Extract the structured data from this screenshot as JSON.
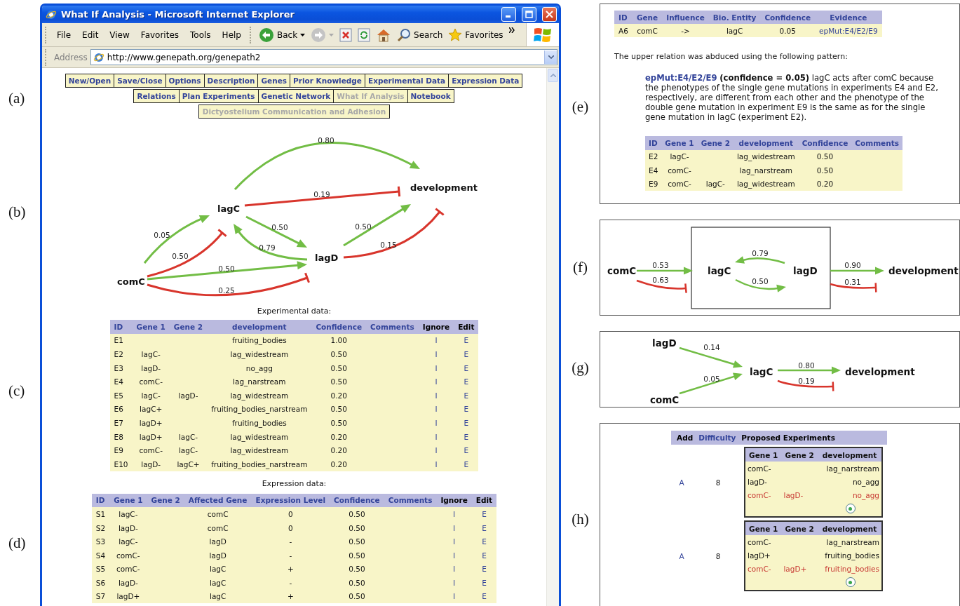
{
  "panel_labels": [
    "(a)",
    "(b)",
    "(c)",
    "(d)",
    "(e)",
    "(f)",
    "(g)",
    "(h)"
  ],
  "browser": {
    "title": "What If Analysis - Microsoft Internet Explorer",
    "menu": [
      "File",
      "Edit",
      "View",
      "Favorites",
      "Tools",
      "Help"
    ],
    "toolbar": [
      {
        "kind": "back",
        "label": "Back"
      },
      {
        "kind": "forward"
      },
      {
        "kind": "stop"
      },
      {
        "kind": "refresh"
      },
      {
        "kind": "home"
      },
      {
        "kind": "search",
        "label": "Search"
      },
      {
        "kind": "favorites",
        "label": "Favorites"
      }
    ],
    "address_label": "Address",
    "url": "http://www.genepath.org/genepath2",
    "nav_rows": [
      [
        {
          "label": "New/Open",
          "selected": false
        },
        {
          "label": "Save/Close",
          "selected": false
        },
        {
          "label": "Options",
          "selected": false
        },
        {
          "label": "Description",
          "selected": false
        },
        {
          "label": "Genes",
          "selected": false
        },
        {
          "label": "Prior Knowledge",
          "selected": false
        },
        {
          "label": "Experimental Data",
          "selected": false
        },
        {
          "label": "Expression Data",
          "selected": false
        }
      ],
      [
        {
          "label": "Relations",
          "selected": false
        },
        {
          "label": "Plan Experiments",
          "selected": false
        },
        {
          "label": "Genetic Network",
          "selected": false
        },
        {
          "label": "What If Analysis",
          "selected": true
        },
        {
          "label": "Notebook",
          "selected": false
        }
      ]
    ],
    "project": "Dictyostelium Communication and Adhesion",
    "network": {
      "nodes": [
        "development",
        "lagC",
        "lagD",
        "comC"
      ],
      "edges": [
        {
          "kind": "activates",
          "weight": "0.80"
        },
        {
          "kind": "inhibits",
          "weight": "0.19"
        },
        {
          "kind": "activates",
          "weight": "0.05"
        },
        {
          "kind": "inhibits",
          "weight": "0.50"
        },
        {
          "kind": "activates",
          "weight": "0.50"
        },
        {
          "kind": "activates",
          "weight": "0.79"
        },
        {
          "kind": "activates",
          "weight": "0.50"
        },
        {
          "kind": "inhibits",
          "weight": "0.25"
        },
        {
          "kind": "activates",
          "weight": "0.50"
        },
        {
          "kind": "inhibits",
          "weight": "0.15"
        }
      ]
    },
    "experimental": {
      "caption": "Experimental data:",
      "columns": [
        {
          "label": "ID",
          "kind": "data"
        },
        {
          "label": "Gene 1",
          "kind": "data"
        },
        {
          "label": "Gene 2",
          "kind": "data"
        },
        {
          "label": "development",
          "kind": "data"
        },
        {
          "label": "Confidence",
          "kind": "data"
        },
        {
          "label": "Comments",
          "kind": "data"
        },
        {
          "label": "Ignore",
          "kind": "action"
        },
        {
          "label": "Edit",
          "kind": "action"
        }
      ],
      "rows": [
        [
          "E1",
          null,
          null,
          "fruiting_bodies",
          "1.00",
          null,
          "I",
          "E"
        ],
        [
          "E2",
          "lagC-",
          null,
          "lag_widestream",
          "0.50",
          null,
          "I",
          "E"
        ],
        [
          "E3",
          "lagD-",
          null,
          "no_agg",
          "0.50",
          null,
          "I",
          "E"
        ],
        [
          "E4",
          "comC-",
          null,
          "lag_narstream",
          "0.50",
          null,
          "I",
          "E"
        ],
        [
          "E5",
          "lagC-",
          "lagD-",
          "lag_widestream",
          "0.20",
          null,
          "I",
          "E"
        ],
        [
          "E6",
          "lagC+",
          null,
          "fruiting_bodies_narstream",
          "0.50",
          null,
          "I",
          "E"
        ],
        [
          "E7",
          "lagD+",
          null,
          "fruiting_bodies",
          "0.50",
          null,
          "I",
          "E"
        ],
        [
          "E8",
          "lagD+",
          "lagC-",
          "lag_widestream",
          "0.20",
          null,
          "I",
          "E"
        ],
        [
          "E9",
          "comC-",
          "lagC-",
          "lag_widestream",
          "0.20",
          null,
          "I",
          "E"
        ],
        [
          "E10",
          "lagD-",
          "lagC+",
          "fruiting_bodies_narstream",
          "0.20",
          null,
          "I",
          "E"
        ]
      ]
    },
    "expression": {
      "caption": "Expression data:",
      "columns": [
        {
          "label": "ID",
          "kind": "data"
        },
        {
          "label": "Gene 1",
          "kind": "data"
        },
        {
          "label": "Gene 2",
          "kind": "data"
        },
        {
          "label": "Affected Gene",
          "kind": "data"
        },
        {
          "label": "Expression Level",
          "kind": "data"
        },
        {
          "label": "Confidence",
          "kind": "data"
        },
        {
          "label": "Comments",
          "kind": "data"
        },
        {
          "label": "Ignore",
          "kind": "action"
        },
        {
          "label": "Edit",
          "kind": "action"
        }
      ],
      "rows": [
        [
          "S1",
          "lagC-",
          null,
          "comC",
          "0",
          "0.50",
          null,
          "I",
          "E"
        ],
        [
          "S2",
          "lagD-",
          null,
          "comC",
          "0",
          "0.50",
          null,
          "I",
          "E"
        ],
        [
          "S3",
          "lagC-",
          null,
          "lagD",
          "-",
          "0.50",
          null,
          "I",
          "E"
        ],
        [
          "S4",
          "comC-",
          null,
          "lagD",
          "-",
          "0.50",
          null,
          "I",
          "E"
        ],
        [
          "S5",
          "comC-",
          null,
          "lagC",
          "+",
          "0.50",
          null,
          "I",
          "E"
        ],
        [
          "S6",
          "lagD-",
          null,
          "lagC",
          "-",
          "0.50",
          null,
          "I",
          "E"
        ],
        [
          "S7",
          "lagD+",
          null,
          "lagC",
          "+",
          "0.50",
          null,
          "I",
          "E"
        ]
      ]
    }
  },
  "relation": {
    "columns": [
      {
        "label": "ID",
        "kind": "data"
      },
      {
        "label": "Gene",
        "kind": "data"
      },
      {
        "label": "Influence",
        "kind": "data"
      },
      {
        "label": "Bio. Entity",
        "kind": "data"
      },
      {
        "label": "Confidence",
        "kind": "data"
      },
      {
        "label": "Evidence",
        "kind": "link"
      }
    ],
    "rows": [
      [
        "A6",
        "comC",
        "->",
        "lagC",
        "0.05",
        "epMut:E4/E2/E9"
      ]
    ]
  },
  "explanation": "The upper relation was abduced using the following pattern:",
  "pattern": {
    "link": "epMut:E4/E2/E9",
    "text": "**(confidence = 0.05)** lagC acts after comC because the phenotypes of the single gene mutations in experiments E4 and E2, respectively, are different from each other and the phenotype of the double gene mutation in experiment E9 is the same as for the single gene mutation in lagC (experiment E2)."
  },
  "evidence": {
    "columns": [
      {
        "label": "ID",
        "kind": "data"
      },
      {
        "label": "Gene 1",
        "kind": "data"
      },
      {
        "label": "Gene 2",
        "kind": "data"
      },
      {
        "label": "development",
        "kind": "data"
      },
      {
        "label": "Confidence",
        "kind": "data"
      },
      {
        "label": "Comments",
        "kind": "data"
      }
    ],
    "rows": [
      [
        "E2",
        "lagC-",
        null,
        "lag_widestream",
        "0.50",
        null
      ],
      [
        "E4",
        "comC-",
        null,
        "lag_narstream",
        "0.50",
        null
      ],
      [
        "E9",
        "comC-",
        "lagC-",
        "lag_widestream",
        "0.20",
        null
      ]
    ]
  },
  "collapsed_network": {
    "nodes": [
      "comC",
      "lagC",
      "lagD",
      "development"
    ],
    "edges": [
      {
        "kind": "activates",
        "weight": "0.53"
      },
      {
        "kind": "inhibits",
        "weight": "0.63"
      },
      {
        "kind": "activates",
        "weight": "0.79"
      },
      {
        "kind": "activates",
        "weight": "0.50"
      },
      {
        "kind": "activates",
        "weight": "0.90"
      },
      {
        "kind": "inhibits",
        "weight": "0.31"
      }
    ]
  },
  "influence_network": {
    "nodes": [
      "lagD",
      "comC",
      "lagC",
      "development"
    ],
    "edges": [
      {
        "kind": "activates",
        "weight": "0.14"
      },
      {
        "kind": "activates",
        "weight": "0.05"
      },
      {
        "kind": "activates",
        "weight": "0.80"
      },
      {
        "kind": "inhibits",
        "weight": "0.19"
      }
    ]
  },
  "plan": {
    "columns": [
      {
        "label": "Add",
        "kind": "action"
      },
      {
        "label": "Difficulty",
        "kind": "data"
      },
      {
        "label": "Proposed Experiments",
        "kind": "action"
      }
    ],
    "rows": [
      {
        "add": "A",
        "difficulty": "8",
        "selected": true,
        "columns": [
          "Gene 1",
          "Gene 2",
          "development"
        ],
        "experiments": [
          {
            "cells": [
              "comC-",
              null,
              "lag_narstream"
            ],
            "proposed": false
          },
          {
            "cells": [
              "lagD-",
              null,
              "no_agg"
            ],
            "proposed": false
          },
          {
            "cells": [
              "comC-",
              "lagD-",
              "no_agg"
            ],
            "proposed": true
          }
        ]
      },
      {
        "add": "A",
        "difficulty": "8",
        "selected": true,
        "columns": [
          "Gene 1",
          "Gene 2",
          "development"
        ],
        "experiments": [
          {
            "cells": [
              "comC-",
              null,
              "lag_narstream"
            ],
            "proposed": false
          },
          {
            "cells": [
              "lagD+",
              null,
              "fruiting_bodies"
            ],
            "proposed": false
          },
          {
            "cells": [
              "comC-",
              "lagD+",
              "fruiting_bodies"
            ],
            "proposed": true
          }
        ]
      }
    ]
  }
}
